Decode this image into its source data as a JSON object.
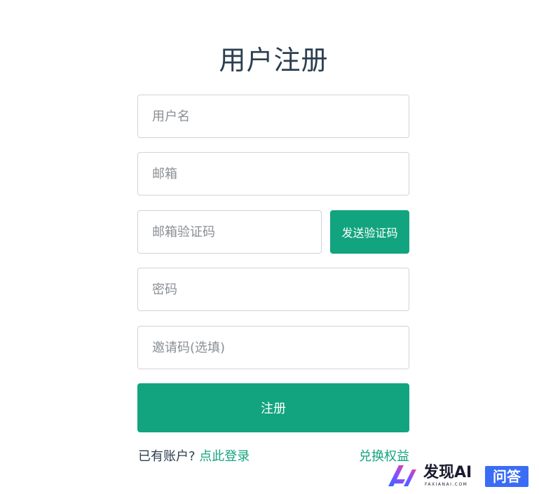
{
  "page": {
    "title": "用户注册"
  },
  "form": {
    "username_placeholder": "用户名",
    "email_placeholder": "邮箱",
    "email_code_placeholder": "邮箱验证码",
    "send_code_label": "发送验证码",
    "password_placeholder": "密码",
    "invite_code_placeholder": "邀请码(选填)",
    "submit_label": "注册"
  },
  "footer": {
    "have_account_text": "已有账户?",
    "login_link": "点此登录",
    "redeem_link": "兑换权益"
  },
  "watermark": {
    "logo_icon": "ai-logo-icon",
    "brand": "发现AI",
    "subtitle": "FAXIANAI.COM",
    "badge": "问答"
  },
  "colors": {
    "accent": "#12a47e",
    "title_text": "#2c3e50",
    "input_border": "#cfd4d8",
    "watermark_badge": "#3b6cf6"
  }
}
